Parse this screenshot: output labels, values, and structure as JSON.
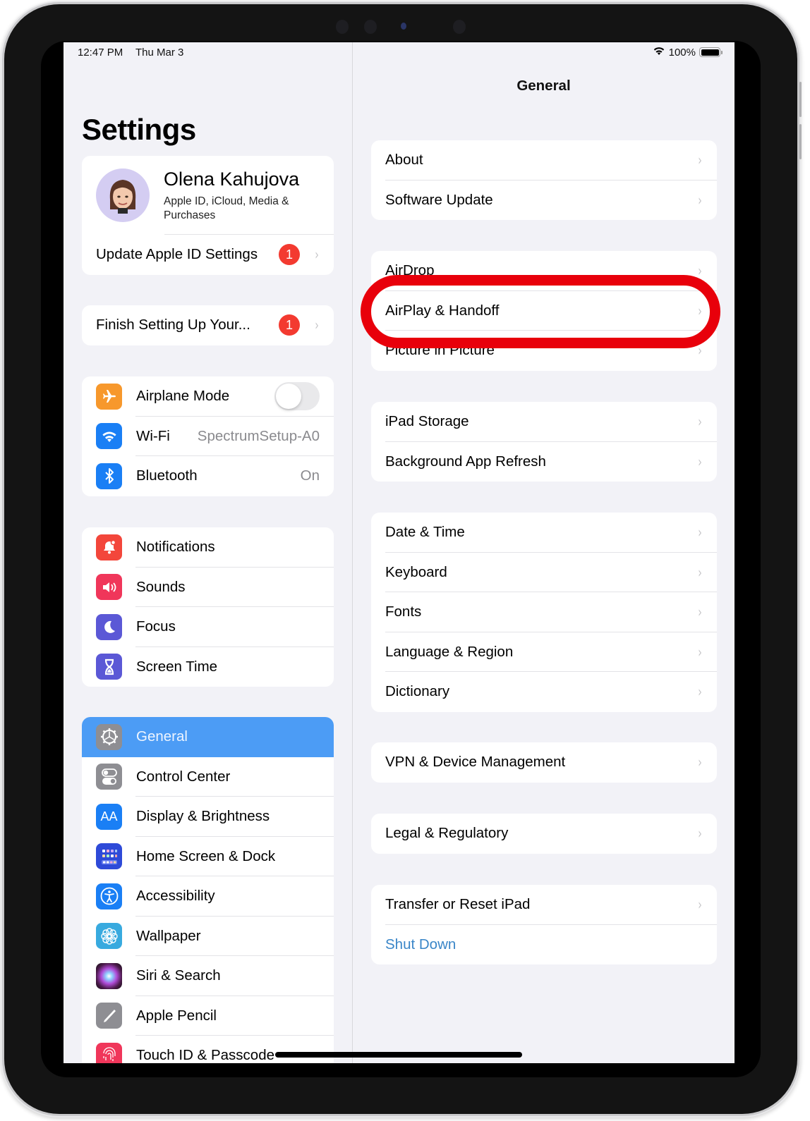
{
  "status_bar": {
    "time": "12:47 PM",
    "date": "Thu Mar 3",
    "battery_percent": "100%",
    "battery_level": 1.0,
    "wifi_icon": "wifi-icon",
    "battery_icon": "battery-icon"
  },
  "sidebar": {
    "title": "Settings",
    "profile": {
      "name": "Olena Kahujova",
      "subtitle": "Apple ID, iCloud, Media & Purchases",
      "avatar": "memoji-avatar"
    },
    "update_apple_id": {
      "label": "Update Apple ID Settings",
      "badge": "1"
    },
    "finish_setup": {
      "label": "Finish Setting Up Your...",
      "badge": "1"
    },
    "connectivity": [
      {
        "label": "Airplane Mode",
        "icon": "airplane-icon",
        "color": "#f7982c",
        "toggle": false
      },
      {
        "label": "Wi-Fi",
        "icon": "wifi-icon",
        "color": "#1a7ff5",
        "value": "SpectrumSetup-A0"
      },
      {
        "label": "Bluetooth",
        "icon": "bluetooth-icon",
        "color": "#1a7ff5",
        "value": "On"
      }
    ],
    "notifications_group": [
      {
        "label": "Notifications",
        "icon": "notifications-icon",
        "color": "#f3463b"
      },
      {
        "label": "Sounds",
        "icon": "sounds-icon",
        "color": "#f0365a"
      },
      {
        "label": "Focus",
        "icon": "focus-moon-icon",
        "color": "#5b58d6"
      },
      {
        "label": "Screen Time",
        "icon": "hourglass-icon",
        "color": "#5b58d6"
      }
    ],
    "general_group": [
      {
        "label": "General",
        "icon": "gear-icon",
        "color": "#8e8e93",
        "selected": true
      },
      {
        "label": "Control Center",
        "icon": "toggles-icon",
        "color": "#8e8e93"
      },
      {
        "label": "Display & Brightness",
        "icon": "text-size-icon",
        "color": "#1a7ff5",
        "glyph": "AA"
      },
      {
        "label": "Home Screen & Dock",
        "icon": "home-grid-icon",
        "color": "#2e4ad8"
      },
      {
        "label": "Accessibility",
        "icon": "accessibility-icon",
        "color": "#1a7ff5"
      },
      {
        "label": "Wallpaper",
        "icon": "flower-icon",
        "color": "#38aadf"
      },
      {
        "label": "Siri & Search",
        "icon": "siri-icon",
        "color": "#222222"
      },
      {
        "label": "Apple Pencil",
        "icon": "pencil-icon",
        "color": "#8e8e93"
      },
      {
        "label": "Touch ID & Passcode",
        "icon": "fingerprint-icon",
        "color": "#f0365a"
      }
    ]
  },
  "detail": {
    "title": "General",
    "groups": [
      [
        {
          "label": "About"
        },
        {
          "label": "Software Update"
        }
      ],
      [
        {
          "label": "AirDrop"
        },
        {
          "label": "AirPlay & Handoff",
          "highlighted": true
        },
        {
          "label": "Picture in Picture"
        }
      ],
      [
        {
          "label": "iPad Storage"
        },
        {
          "label": "Background App Refresh"
        }
      ],
      [
        {
          "label": "Date & Time"
        },
        {
          "label": "Keyboard"
        },
        {
          "label": "Fonts"
        },
        {
          "label": "Language & Region"
        },
        {
          "label": "Dictionary"
        }
      ],
      [
        {
          "label": "VPN & Device Management"
        }
      ],
      [
        {
          "label": "Legal & Regulatory"
        }
      ],
      [
        {
          "label": "Transfer or Reset iPad"
        },
        {
          "label": "Shut Down",
          "action": true
        }
      ]
    ],
    "chevron": "›",
    "highlight_color": "#e8000b",
    "action_color": "#3a86c8"
  }
}
